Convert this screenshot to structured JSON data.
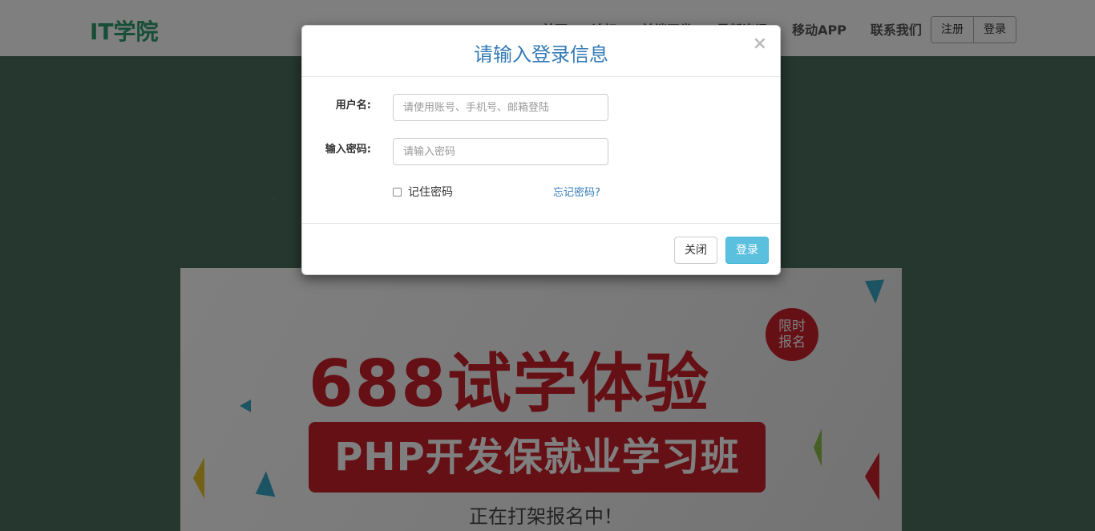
{
  "brand": "IT学院",
  "nav": {
    "links": [
      "首页",
      "论坛",
      "前端开发",
      "最新资讯",
      "移动APP",
      "联系我们"
    ],
    "register_label": "注册",
    "login_label": "登录"
  },
  "banner": {
    "tag": "限时报名",
    "title": "688试学体验",
    "pill": "PHP开发保就业学习班",
    "subtitle": "正在打架报名中！"
  },
  "modal": {
    "title": "请输入登录信息",
    "close_symbol": "×",
    "username_label": "用户名:",
    "username_placeholder": "请使用账号、手机号、邮箱登陆",
    "password_label": "输入密码:",
    "password_placeholder": "请输入密码",
    "remember_label": "记住密码",
    "forgot_label": "忘记密码?",
    "close_button": "关闭",
    "login_button": "登录"
  },
  "colors": {
    "brand": "#2e9c6f",
    "banner_red": "#c9202b",
    "link_blue": "#337ab7",
    "login_button": "#5bc0de"
  }
}
